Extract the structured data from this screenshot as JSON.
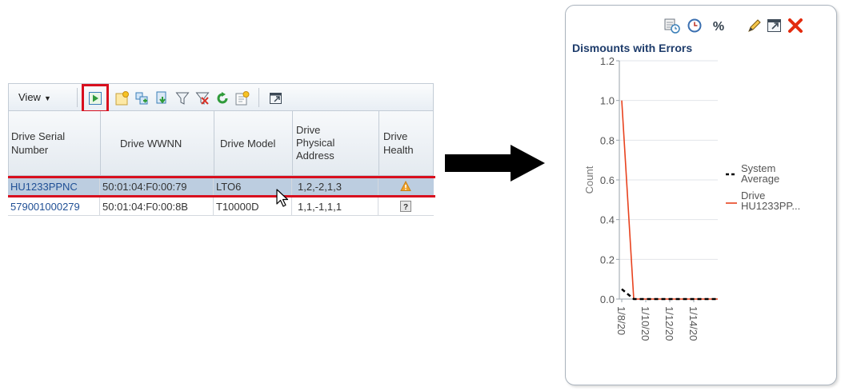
{
  "toolbar": {
    "view_label": "View",
    "icons": [
      "run-report-icon",
      "new-report-icon",
      "add-to-report-icon",
      "export-icon",
      "filter-icon",
      "clear-filter-icon",
      "refresh-icon",
      "save-report-icon",
      "detach-icon"
    ]
  },
  "table": {
    "columns": [
      {
        "lines": [
          "Drive Serial",
          "Number"
        ]
      },
      {
        "lines": [
          "Drive WWNN"
        ]
      },
      {
        "lines": [
          "Drive Model"
        ]
      },
      {
        "lines": [
          "Drive",
          "Physical",
          "Address"
        ]
      },
      {
        "lines": [
          "Drive",
          "Health"
        ]
      }
    ],
    "rows": [
      {
        "serial": "HU1233PPNC",
        "wwnn": "50:01:04:F0:00:79",
        "model": "LTO6",
        "address": "1,2,-2,1,3",
        "health": "warning"
      },
      {
        "serial": "579001000279",
        "wwnn": "50:01:04:F0:00:8B",
        "model": "T10000D",
        "address": "1,1,-1,1,1",
        "health": "unknown"
      }
    ]
  },
  "chart_card": {
    "icons": [
      "schedule-icon",
      "clock-icon",
      "percent-icon",
      "edit-icon",
      "detach-icon",
      "close-icon"
    ],
    "colors": {
      "accent": "#e8421e",
      "close": "#e32b0e",
      "title": "#1e3c6b"
    }
  },
  "chart_data": {
    "type": "line",
    "title": "Dismounts with Errors",
    "ylabel": "Count",
    "xlabel": "",
    "ylim": [
      0,
      1.2
    ],
    "yticks": [
      "0.0",
      "0.2",
      "0.4",
      "0.6",
      "0.8",
      "1.0",
      "1.2"
    ],
    "xticks": [
      "1/8/20",
      "1/10/20",
      "1/12/20",
      "1/14/20"
    ],
    "grid": true,
    "legend_position": "right",
    "series": [
      {
        "name": "System Average",
        "color": "#000000",
        "style": "dashed",
        "x": [
          0,
          1,
          2,
          3,
          4,
          5,
          6,
          7,
          8
        ],
        "values": [
          0.05,
          0,
          0,
          0,
          0,
          0,
          0,
          0,
          0
        ]
      },
      {
        "name": "Drive HU1233PP...",
        "color": "#e8421e",
        "style": "solid",
        "x": [
          0,
          1,
          2,
          3,
          4,
          5,
          6,
          7,
          8
        ],
        "values": [
          1.0,
          0,
          0,
          0,
          0,
          0,
          0,
          0,
          0
        ]
      }
    ],
    "legend": [
      {
        "lines": [
          "System",
          "Average"
        ],
        "color": "#000000",
        "style": "dashed"
      },
      {
        "lines": [
          "Drive",
          "HU1233PP..."
        ],
        "color": "#e8421e",
        "style": "solid"
      }
    ]
  }
}
